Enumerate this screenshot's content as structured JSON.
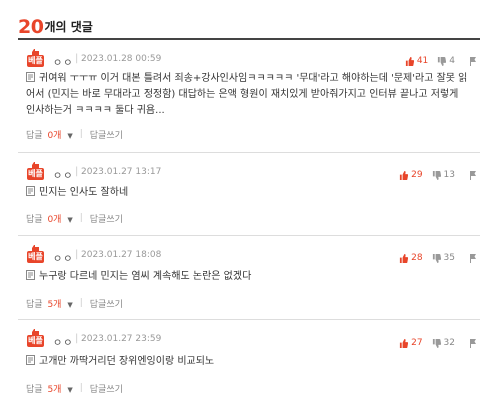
{
  "header": {
    "count": "20",
    "suffix": "개의 댓글"
  },
  "best_badge": "베플",
  "comments": [
    {
      "author": "ㅇㅇ",
      "date": "2023.01.28 00:59",
      "likes": "41",
      "dislikes": "4",
      "text": "귀여워 ㅜㅜㅠ 이거 대본 틀려서 죄송+강사인사임ㅋㅋㅋㅋㅋ '무대'라고 해야하는데 '문제'라고 잘못 읽어서 (민지는 바로 무대라고 정정함) 대답하는 은액 형원이 재치있게 받아줘가지고 인터뷰 끝나고 저렇게 인사하는거 ㅋㅋㅋㅋ 둘다 귀욤...",
      "reply_label": "답글",
      "reply_count": "0개",
      "write_label": "답글쓰기"
    },
    {
      "author": "ㅇㅇ",
      "date": "2023.01.27 13:17",
      "likes": "29",
      "dislikes": "13",
      "text": "민지는 인사도 잘하네",
      "reply_label": "답글",
      "reply_count": "0개",
      "write_label": "답글쓰기"
    },
    {
      "author": "ㅇㅇ",
      "date": "2023.01.27 18:08",
      "likes": "28",
      "dislikes": "35",
      "text": "누구랑 다르네 민지는 염씨 계속해도 논란은 없겠다",
      "reply_label": "답글",
      "reply_count": "5개",
      "write_label": "답글쓰기"
    },
    {
      "author": "ㅇㅇ",
      "date": "2023.01.27 23:59",
      "likes": "27",
      "dislikes": "32",
      "text": "고개만 까딱거리던 장위엔잉이랑 비교되노",
      "reply_label": "답글",
      "reply_count": "5개",
      "write_label": "답글쓰기"
    }
  ],
  "icons": {
    "like": "thumbs-up-icon",
    "dislike": "thumbs-down-icon",
    "report": "report-icon",
    "doc": "document-icon"
  },
  "colors": {
    "accent": "#e8452a"
  }
}
